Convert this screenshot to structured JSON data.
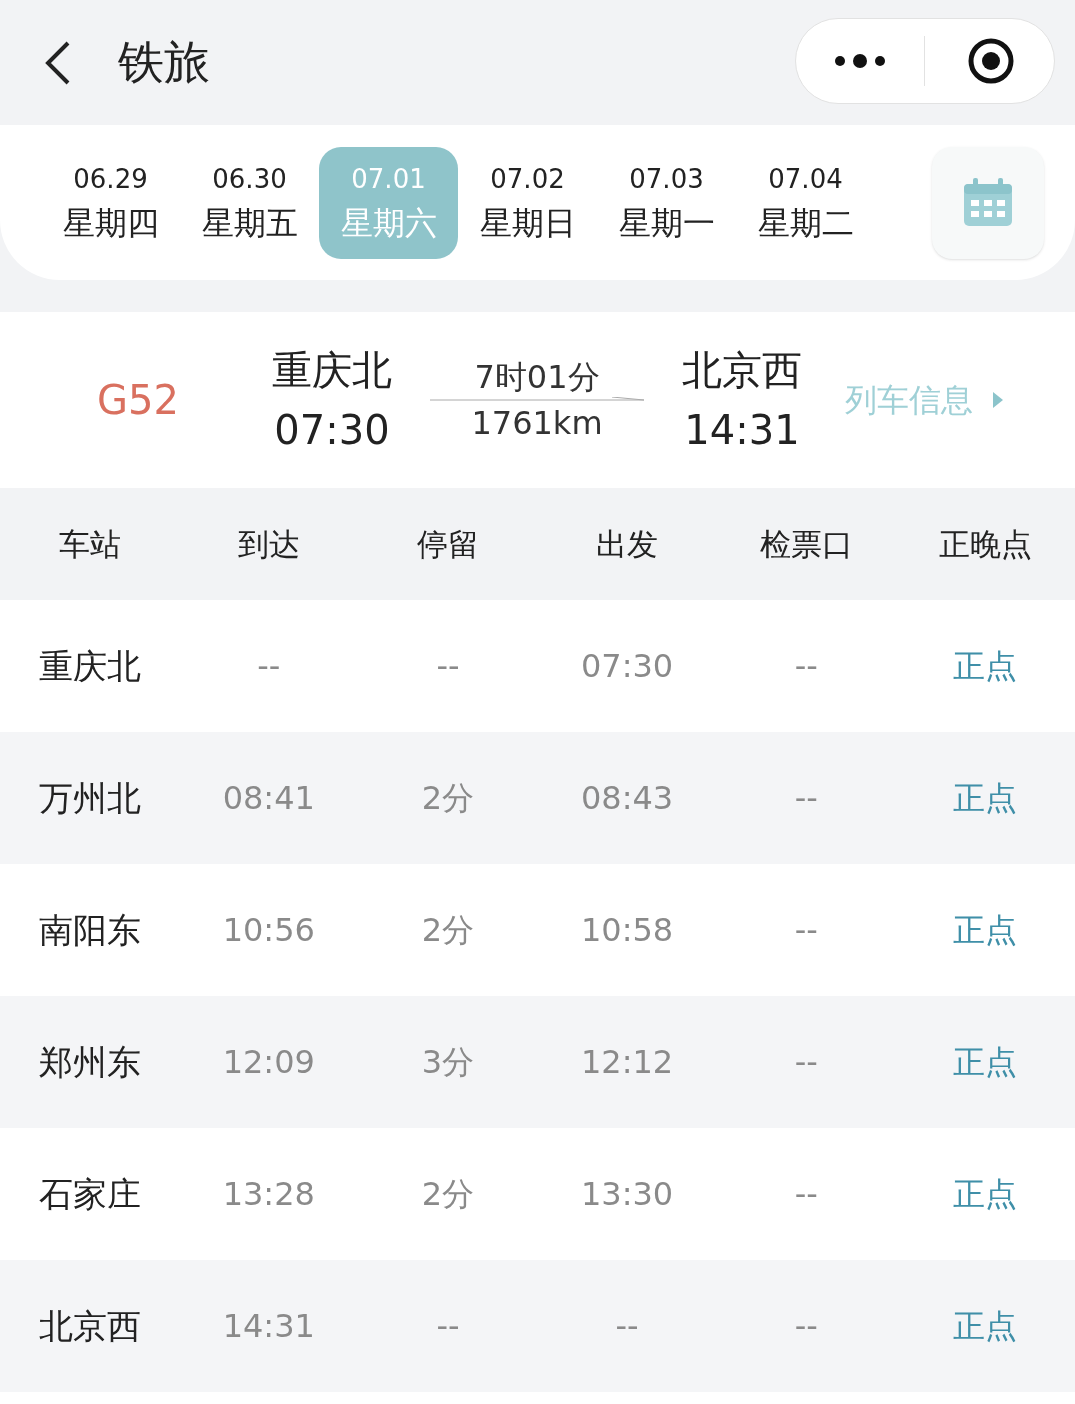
{
  "header": {
    "title": "铁旅"
  },
  "dates": [
    {
      "date": "06.29",
      "weekday": "星期四",
      "selected": false
    },
    {
      "date": "06.30",
      "weekday": "星期五",
      "selected": false
    },
    {
      "date": "07.01",
      "weekday": "星期六",
      "selected": true
    },
    {
      "date": "07.02",
      "weekday": "星期日",
      "selected": false
    },
    {
      "date": "07.03",
      "weekday": "星期一",
      "selected": false
    },
    {
      "date": "07.04",
      "weekday": "星期二",
      "selected": false
    }
  ],
  "train": {
    "number": "G52",
    "from": {
      "station": "重庆北",
      "time": "07:30"
    },
    "duration": "7时01分",
    "distance": "1761km",
    "to": {
      "station": "北京西",
      "time": "14:31"
    },
    "info_link": "列车信息"
  },
  "table": {
    "columns": [
      "车站",
      "到达",
      "停留",
      "出发",
      "检票口",
      "正晚点"
    ],
    "rows": [
      [
        "重庆北",
        "--",
        "--",
        "07:30",
        "--",
        "正点"
      ],
      [
        "万州北",
        "08:41",
        "2分",
        "08:43",
        "--",
        "正点"
      ],
      [
        "南阳东",
        "10:56",
        "2分",
        "10:58",
        "--",
        "正点"
      ],
      [
        "郑州东",
        "12:09",
        "3分",
        "12:12",
        "--",
        "正点"
      ],
      [
        "石家庄",
        "13:28",
        "2分",
        "13:30",
        "--",
        "正点"
      ],
      [
        "北京西",
        "14:31",
        "--",
        "--",
        "--",
        "正点"
      ]
    ]
  }
}
